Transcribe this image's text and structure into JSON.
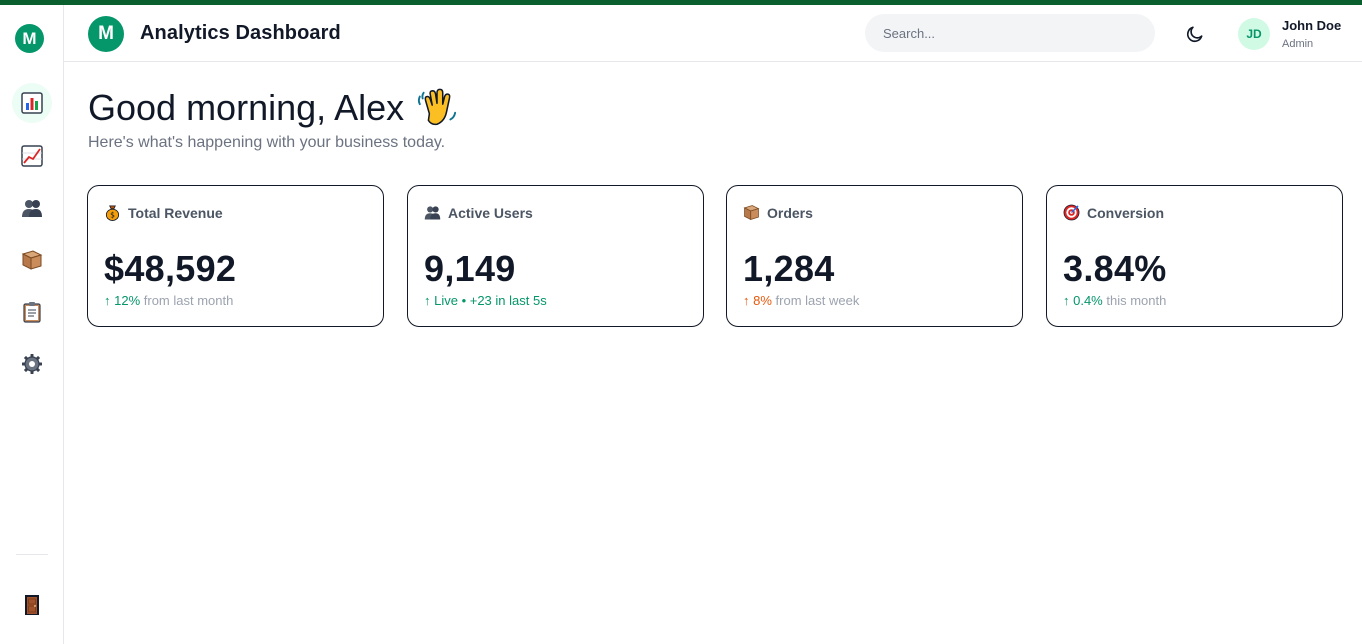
{
  "app": {
    "logo_letter": "M",
    "title": "Analytics Dashboard"
  },
  "sidebar": {
    "logo_letter": "M",
    "items": [
      {
        "name": "dashboard",
        "icon": "bar-chart-icon",
        "active": true
      },
      {
        "name": "analytics",
        "icon": "trending-chart-icon",
        "active": false
      },
      {
        "name": "users",
        "icon": "users-icon",
        "active": false
      },
      {
        "name": "products",
        "icon": "package-icon",
        "active": false
      },
      {
        "name": "reports",
        "icon": "clipboard-icon",
        "active": false
      },
      {
        "name": "settings",
        "icon": "gear-icon",
        "active": false
      }
    ],
    "bottom_item": {
      "name": "logout",
      "icon": "door-icon"
    }
  },
  "header": {
    "search_placeholder": "Search...",
    "theme_icon": "moon-icon",
    "user": {
      "initials": "JD",
      "name": "John Doe",
      "role": "Admin"
    }
  },
  "main": {
    "greeting": "Good morning, Alex",
    "greeting_icon": "waving-hand-icon",
    "subtitle": "Here's what's happening with your business today."
  },
  "cards": [
    {
      "label": "Total Revenue",
      "icon": "money-bag-icon",
      "value": "$48,592",
      "delta": "↑ 12%",
      "delta_color": "#059669",
      "suffix": " from last month"
    },
    {
      "label": "Active Users",
      "icon": "users-icon",
      "value": "9,149",
      "delta": "↑ Live • +23 in last 5s",
      "delta_color": "#059669",
      "suffix": ""
    },
    {
      "label": "Orders",
      "icon": "package-icon",
      "value": "1,284",
      "delta": "↑ 8%",
      "delta_color": "#ea580c",
      "suffix": " from last week"
    },
    {
      "label": "Conversion",
      "icon": "target-icon",
      "value": "3.84%",
      "delta": "↑ 0.4%",
      "delta_color": "#059669",
      "suffix": " this month"
    }
  ],
  "colors": {
    "brand": "#059669",
    "top_stripe": "#0b5e2e",
    "positive": "#059669",
    "warning": "#ea580c"
  }
}
